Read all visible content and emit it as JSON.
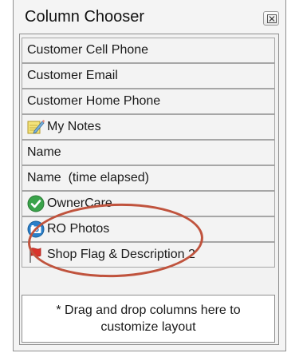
{
  "window": {
    "title": "Column Chooser",
    "close_icon": "close-icon"
  },
  "columns": [
    {
      "label": "Customer Cell Phone",
      "icon": null
    },
    {
      "label": "Customer Email",
      "icon": null
    },
    {
      "label": "Customer Home Phone",
      "icon": null
    },
    {
      "label": "My Notes",
      "icon": "notes-pencil-icon"
    },
    {
      "label": "Name",
      "icon": null
    },
    {
      "label": "Name  (time elapsed)",
      "icon": null
    },
    {
      "label": "OwnerCare",
      "icon": "green-check-icon"
    },
    {
      "label": "RO Photos",
      "icon": "camera-icon"
    },
    {
      "label": "Shop Flag & Description 2",
      "icon": "flag-icon"
    }
  ],
  "footer": {
    "hint": "* Drag and drop columns here to customize layout"
  },
  "colors": {
    "annotation_circle": "#c0533d",
    "ownercare_green": "#3aa34a",
    "photos_blue": "#2a7fc9",
    "flag_red": "#d9342b"
  }
}
